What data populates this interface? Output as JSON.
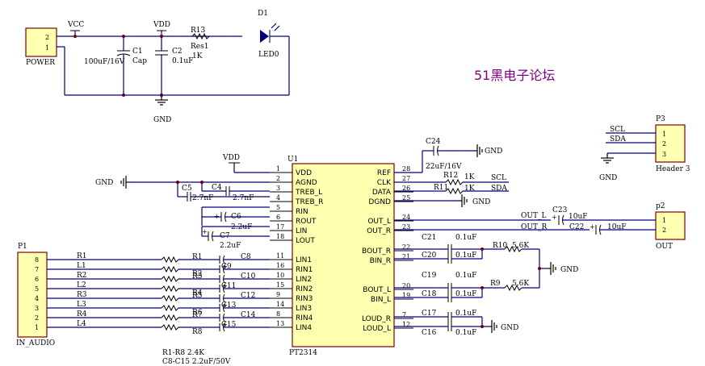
{
  "title": "51黑电子论坛",
  "power": {
    "connector": "POWER",
    "pins": [
      "2",
      "1"
    ],
    "vcc": "VCC",
    "vdd": "VDD",
    "gnd": "GND",
    "c1": "C1",
    "c1_type": "Cap",
    "c1_value": "100uF/16V",
    "c2": "C2",
    "c2_value": "0.1uF",
    "r13": "R13",
    "r13_type": "Res1",
    "r13_value": "1K",
    "d1": "D1",
    "led": "LED0"
  },
  "ic": {
    "ref": "U1",
    "part": "PT2314",
    "vdd_label": "VDD",
    "gnd_label": "GND",
    "left_pins": [
      {
        "num": "1",
        "name": "VDD"
      },
      {
        "num": "2",
        "name": "AGND"
      },
      {
        "num": "3",
        "name": "TREB_L"
      },
      {
        "num": "4",
        "name": "TREB_R"
      },
      {
        "num": "5",
        "name": "RIN"
      },
      {
        "num": "6",
        "name": "ROUT"
      },
      {
        "num": "17",
        "name": "LIN"
      },
      {
        "num": "18",
        "name": "LOUT"
      },
      {
        "num": "11",
        "name": "LIN1"
      },
      {
        "num": "16",
        "name": "RIN1"
      },
      {
        "num": "10",
        "name": "LIN2"
      },
      {
        "num": "15",
        "name": "RIN2"
      },
      {
        "num": "9",
        "name": "RIN3"
      },
      {
        "num": "14",
        "name": "LIN3"
      },
      {
        "num": "8",
        "name": "RIN4"
      },
      {
        "num": "13",
        "name": "LIN4"
      }
    ],
    "right_pins": [
      {
        "num": "28",
        "name": "REF"
      },
      {
        "num": "27",
        "name": "CLK"
      },
      {
        "num": "26",
        "name": "DATA"
      },
      {
        "num": "25",
        "name": "DGND"
      },
      {
        "num": "24",
        "name": "OUT_L"
      },
      {
        "num": "23",
        "name": "OUT_R"
      },
      {
        "num": "22",
        "name": "BOUT_R"
      },
      {
        "num": "21",
        "name": "BIN_R"
      },
      {
        "num": "20",
        "name": "BOUT_L"
      },
      {
        "num": "19",
        "name": "BIN_L"
      },
      {
        "num": "7",
        "name": "LOUD_R"
      },
      {
        "num": "12",
        "name": "LOUD_L"
      }
    ]
  },
  "caps": {
    "c24": "C24",
    "c24_value": "22uF/16V",
    "c5": "C5",
    "c5_value": "2.7nF",
    "c4": "C4",
    "c4_value": "2.7nF",
    "c6": "C6",
    "c6_value": "2.2uF",
    "c7": "C7",
    "c7_value": "2.2uF",
    "c21": "C21",
    "c20": "C20",
    "c19": "C19",
    "c18": "C18",
    "c17": "C17",
    "c16": "C16",
    "small_value": "0.1uF",
    "c23": "C23",
    "c22": "C22",
    "out_value": "10uF",
    "c8": "C8",
    "c9": "C9",
    "c10": "C10",
    "c11": "C11",
    "c12": "C12",
    "c13": "C13",
    "c14": "C14",
    "c15": "C15"
  },
  "resistors": {
    "r12": "R12",
    "r11": "R11",
    "r12_value": "1K",
    "r11_value": "1K",
    "r10": "R10",
    "r9": "R9",
    "r10_value": "5.6K",
    "r9_value": "5.6K",
    "input": [
      "R1",
      "R2",
      "R3",
      "R4",
      "R5",
      "R6",
      "R7",
      "R8"
    ]
  },
  "nets": {
    "scl": "SCL",
    "sda": "SDA",
    "out_l": "OUT_L",
    "out_r": "OUT_R",
    "input_lines": [
      "R1",
      "L1",
      "R2",
      "L2",
      "R3",
      "L3",
      "R4",
      "L4"
    ]
  },
  "p3": {
    "ref": "P3",
    "name": "Header 3",
    "pins": [
      "1",
      "2",
      "3"
    ],
    "net1": "SCL",
    "net2": "SDA"
  },
  "p2": {
    "ref": "p2",
    "name": "OUT",
    "pins": [
      "1",
      "2"
    ]
  },
  "p1": {
    "ref": "P1",
    "name": "IN_AUDIO",
    "pins": [
      "8",
      "7",
      "6",
      "5",
      "4",
      "3",
      "2",
      "1"
    ]
  },
  "notes": {
    "line1": "R1-R8 2.4K",
    "line2": "C8-C15 2.2uF/50V"
  }
}
